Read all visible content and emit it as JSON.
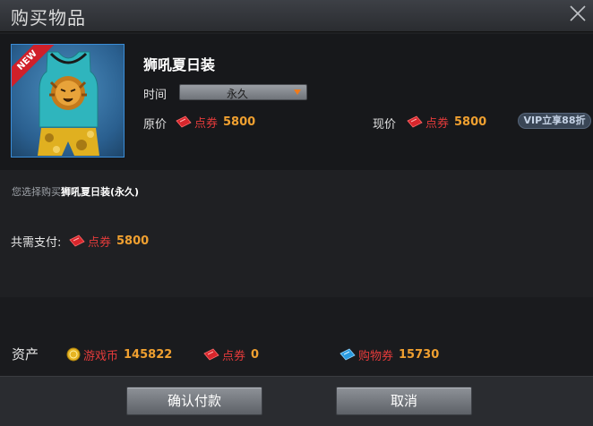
{
  "dialog": {
    "title": "购买物品"
  },
  "item": {
    "badge": "NEW",
    "name": "狮吼夏日装",
    "time_label": "时间",
    "duration_selected": "永久",
    "original_price_label": "原价",
    "original_price_currency": "点券",
    "original_price": "5800",
    "current_price_label": "现价",
    "current_price_currency": "点券",
    "current_price": "5800",
    "vip_badge": "VIP立享88折"
  },
  "summary": {
    "prefix": "您选择购买",
    "item_name": "狮吼夏日装",
    "suffix": "(永久)",
    "total_label": "共需支付:",
    "total_currency": "点券",
    "total_amount": "5800"
  },
  "assets": {
    "label": "资产",
    "game_coin_label": "游戏币",
    "game_coin_amount": "145822",
    "ticket_label": "点券",
    "ticket_amount": "0",
    "voucher_label": "购物券",
    "voucher_amount": "15730"
  },
  "buttons": {
    "confirm": "确认付款",
    "cancel": "取消"
  },
  "colors": {
    "currency_red": "#e53b3b",
    "amount_orange": "#f0a030",
    "frame_blue": "#3a8dd8"
  },
  "icons": {
    "close": "close-icon",
    "ticket": "red-ticket-icon",
    "coin": "gold-coin-icon",
    "voucher": "blue-ticket-icon",
    "dropdown": "chevron-down-icon"
  }
}
